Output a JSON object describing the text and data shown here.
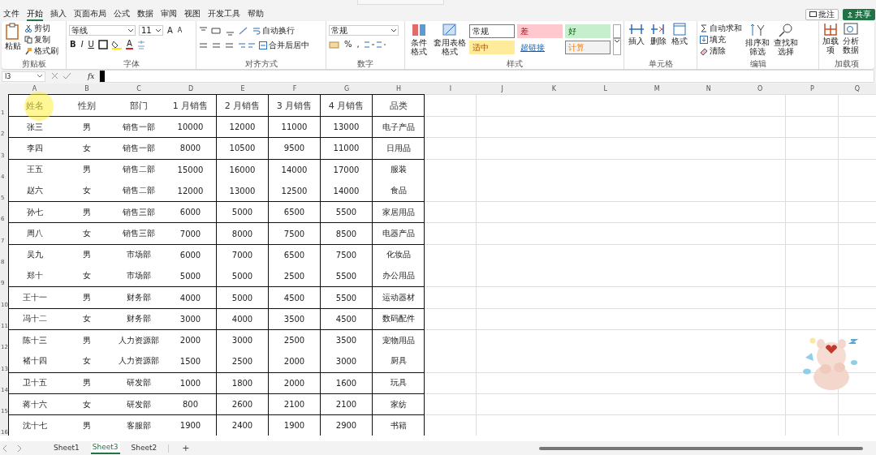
{
  "menu_tabs": [
    {
      "label": "文件",
      "selected": false
    },
    {
      "label": "开始",
      "selected": true
    },
    {
      "label": "插入",
      "selected": false
    },
    {
      "label": "页面布局",
      "selected": false
    },
    {
      "label": "公式",
      "selected": false
    },
    {
      "label": "数据",
      "selected": false
    },
    {
      "label": "审阅",
      "selected": false
    },
    {
      "label": "视图",
      "selected": false
    },
    {
      "label": "开发工具",
      "selected": false
    },
    {
      "label": "帮助",
      "selected": false
    }
  ],
  "comments_button": "批注",
  "share_button": "共享",
  "ribbon": {
    "clipboard": {
      "paste": "粘贴",
      "cut": "剪切",
      "copy": "复制",
      "format_painter": "格式刷",
      "label": "剪贴板"
    },
    "font": {
      "name": "等线",
      "size": "11",
      "grow": "A",
      "shrink": "A",
      "bold": "B",
      "italic": "I",
      "underline": "U",
      "color_letter": "A",
      "label": "字体"
    },
    "alignment": {
      "wrap": "自动换行",
      "merge": "合并后居中",
      "label": "对齐方式"
    },
    "number": {
      "format": "常规",
      "percent": "%",
      "comma": ",",
      "label": "数字"
    },
    "styles": {
      "conditional": "条件格式",
      "table": "套用表格格式",
      "cell_styles": [
        {
          "label": "常规",
          "kind": "normal"
        },
        {
          "label": "差",
          "kind": "bad"
        },
        {
          "label": "好",
          "kind": "good"
        },
        {
          "label": "适中",
          "kind": "neutral"
        },
        {
          "label": "超链接",
          "kind": "link"
        },
        {
          "label": "计算",
          "kind": "calc"
        }
      ],
      "label": "样式"
    },
    "cells": {
      "insert": "插入",
      "delete": "删除",
      "format": "格式",
      "label": "单元格"
    },
    "editing": {
      "autosum": "自动求和",
      "fill": "填充",
      "clear": "清除",
      "sort": "排序和筛选",
      "find": "查找和选择",
      "label": "编辑"
    },
    "addins": {
      "addins": "加载项",
      "analyze": "分析数据",
      "label": "加载项"
    }
  },
  "formula_bar": {
    "name_box": "I3",
    "fx": "fx"
  },
  "columns": [
    "A",
    "B",
    "C",
    "D",
    "E",
    "F",
    "G",
    "H",
    "I",
    "J",
    "K",
    "L",
    "M",
    "N",
    "O",
    "P",
    "Q"
  ],
  "table": {
    "header_row_number": "1",
    "header": [
      "姓名",
      "性别",
      "部门",
      "1 月销售",
      "2 月销售",
      "3 月销售",
      "4 月销售",
      "品类"
    ],
    "rows": [
      {
        "row_number": "2",
        "divider_above": true,
        "cells": [
          "张三",
          "男",
          "销售一部",
          "10000",
          "12000",
          "11000",
          "13000",
          "电子产品"
        ]
      },
      {
        "row_number": "3",
        "divider_above": true,
        "cells": [
          "李四",
          "女",
          "销售一部",
          "8000",
          "10500",
          "9500",
          "11000",
          "日用品"
        ]
      },
      {
        "row_number": "4",
        "divider_above": true,
        "cells": [
          "王五",
          "男",
          "销售二部",
          "15000",
          "16000",
          "14000",
          "17000",
          "服装"
        ]
      },
      {
        "row_number": "5",
        "divider_above": false,
        "cells": [
          "赵六",
          "女",
          "销售二部",
          "12000",
          "13000",
          "12500",
          "14000",
          "食品"
        ]
      },
      {
        "row_number": "6",
        "divider_above": true,
        "cells": [
          "孙七",
          "男",
          "销售三部",
          "6000",
          "5000",
          "6500",
          "5500",
          "家居用品"
        ]
      },
      {
        "row_number": "7",
        "divider_above": true,
        "cells": [
          "周八",
          "女",
          "销售三部",
          "7000",
          "8000",
          "7500",
          "8500",
          "电器产品"
        ]
      },
      {
        "row_number": "8",
        "divider_above": true,
        "cells": [
          "吴九",
          "男",
          "市场部",
          "6000",
          "7000",
          "6500",
          "7500",
          "化妆品"
        ]
      },
      {
        "row_number": "9",
        "divider_above": false,
        "cells": [
          "郑十",
          "女",
          "市场部",
          "5000",
          "5000",
          "2500",
          "5500",
          "办公用品"
        ]
      },
      {
        "row_number": "10",
        "divider_above": true,
        "cells": [
          "王十一",
          "男",
          "财务部",
          "4000",
          "5000",
          "4500",
          "5500",
          "运动器材"
        ]
      },
      {
        "row_number": "11",
        "divider_above": true,
        "cells": [
          "冯十二",
          "女",
          "财务部",
          "3000",
          "4000",
          "3500",
          "4500",
          "数码配件"
        ]
      },
      {
        "row_number": "12",
        "divider_above": true,
        "cells": [
          "陈十三",
          "男",
          "人力资源部",
          "2000",
          "3000",
          "2500",
          "3500",
          "宠物用品"
        ]
      },
      {
        "row_number": "13",
        "divider_above": false,
        "cells": [
          "褚十四",
          "女",
          "人力资源部",
          "1500",
          "2500",
          "2000",
          "3000",
          "厨具"
        ]
      },
      {
        "row_number": "14",
        "divider_above": true,
        "cells": [
          "卫十五",
          "男",
          "研发部",
          "1000",
          "1800",
          "2000",
          "1600",
          "玩具"
        ]
      },
      {
        "row_number": "15",
        "divider_above": true,
        "cells": [
          "蒋十六",
          "女",
          "研发部",
          "800",
          "2600",
          "2100",
          "2100",
          "家纺"
        ]
      },
      {
        "row_number": "16",
        "divider_above": true,
        "cells": [
          "沈十七",
          "男",
          "客服部",
          "1900",
          "2400",
          "1900",
          "2900",
          "书籍"
        ]
      }
    ]
  },
  "sheet_tabs": [
    {
      "label": "Sheet1",
      "selected": false
    },
    {
      "label": "Sheet3",
      "selected": true
    },
    {
      "label": "Sheet2",
      "selected": false
    }
  ],
  "add_sheet": "+"
}
